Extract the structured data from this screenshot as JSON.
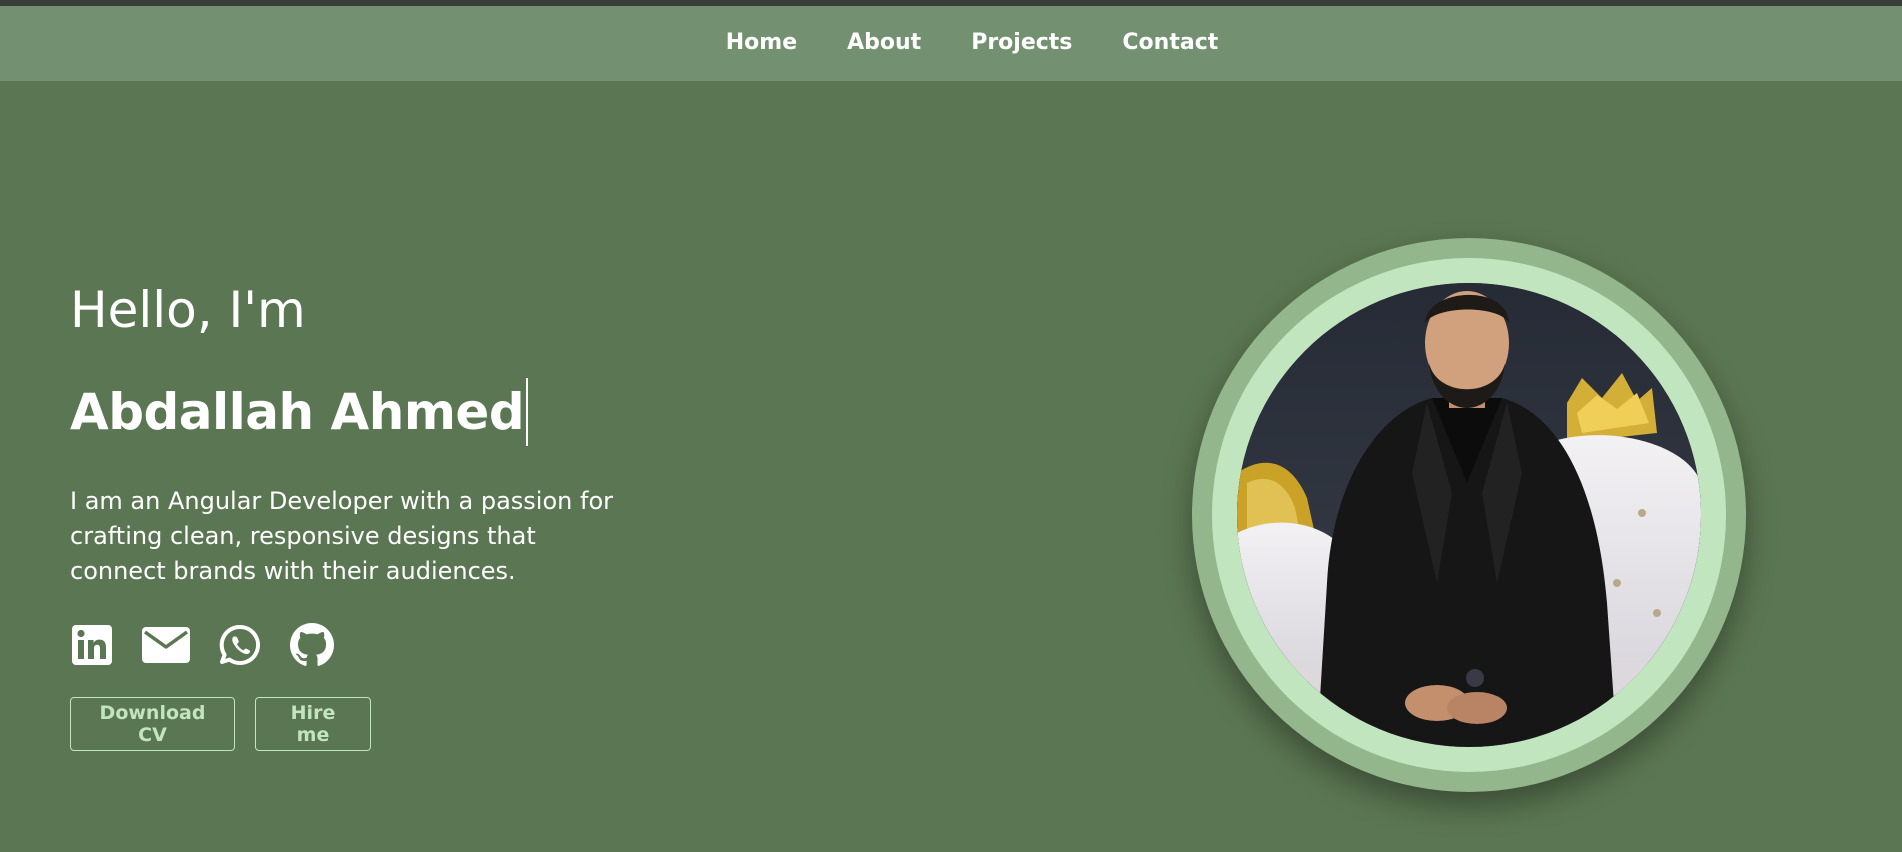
{
  "nav": {
    "items": [
      {
        "label": "Home"
      },
      {
        "label": "About"
      },
      {
        "label": "Projects"
      },
      {
        "label": "Contact"
      }
    ]
  },
  "hero": {
    "greeting": "Hello, I'm",
    "name": "Abdallah Ahmed",
    "bio": "I am an Angular Developer with a passion for crafting clean, responsive designs that connect brands with their audiences.",
    "socials": [
      {
        "icon": "linkedin-icon"
      },
      {
        "icon": "envelope-icon"
      },
      {
        "icon": "whatsapp-icon"
      },
      {
        "icon": "github-icon"
      }
    ],
    "buttons": {
      "download_cv": "Download CV",
      "hire_me": "Hire me"
    }
  },
  "colors": {
    "background": "#5b7652",
    "navbar": "#739170",
    "accent": "#c1e5be",
    "ring_outer": "#93b68d"
  }
}
